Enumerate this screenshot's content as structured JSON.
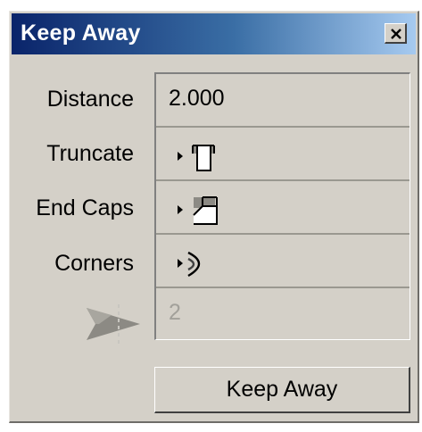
{
  "window": {
    "title": "Keep Away"
  },
  "fields": {
    "distance": {
      "label": "Distance",
      "value": "2.000"
    },
    "truncate": {
      "label": "Truncate",
      "icon": "truncate-style-icon"
    },
    "end_caps": {
      "label": "End Caps",
      "icon": "end-cap-style-icon"
    },
    "corners": {
      "label": "Corners",
      "icon": "corner-style-icon"
    },
    "copies": {
      "icon": "copies-arrow-icon",
      "value": "2"
    }
  },
  "actions": {
    "keep_away_label": "Keep Away"
  },
  "colors": {
    "title_start": "#0a246a",
    "title_end": "#a6caf0",
    "face": "#d4d0c8",
    "disabled_text": "#a2a09a"
  }
}
